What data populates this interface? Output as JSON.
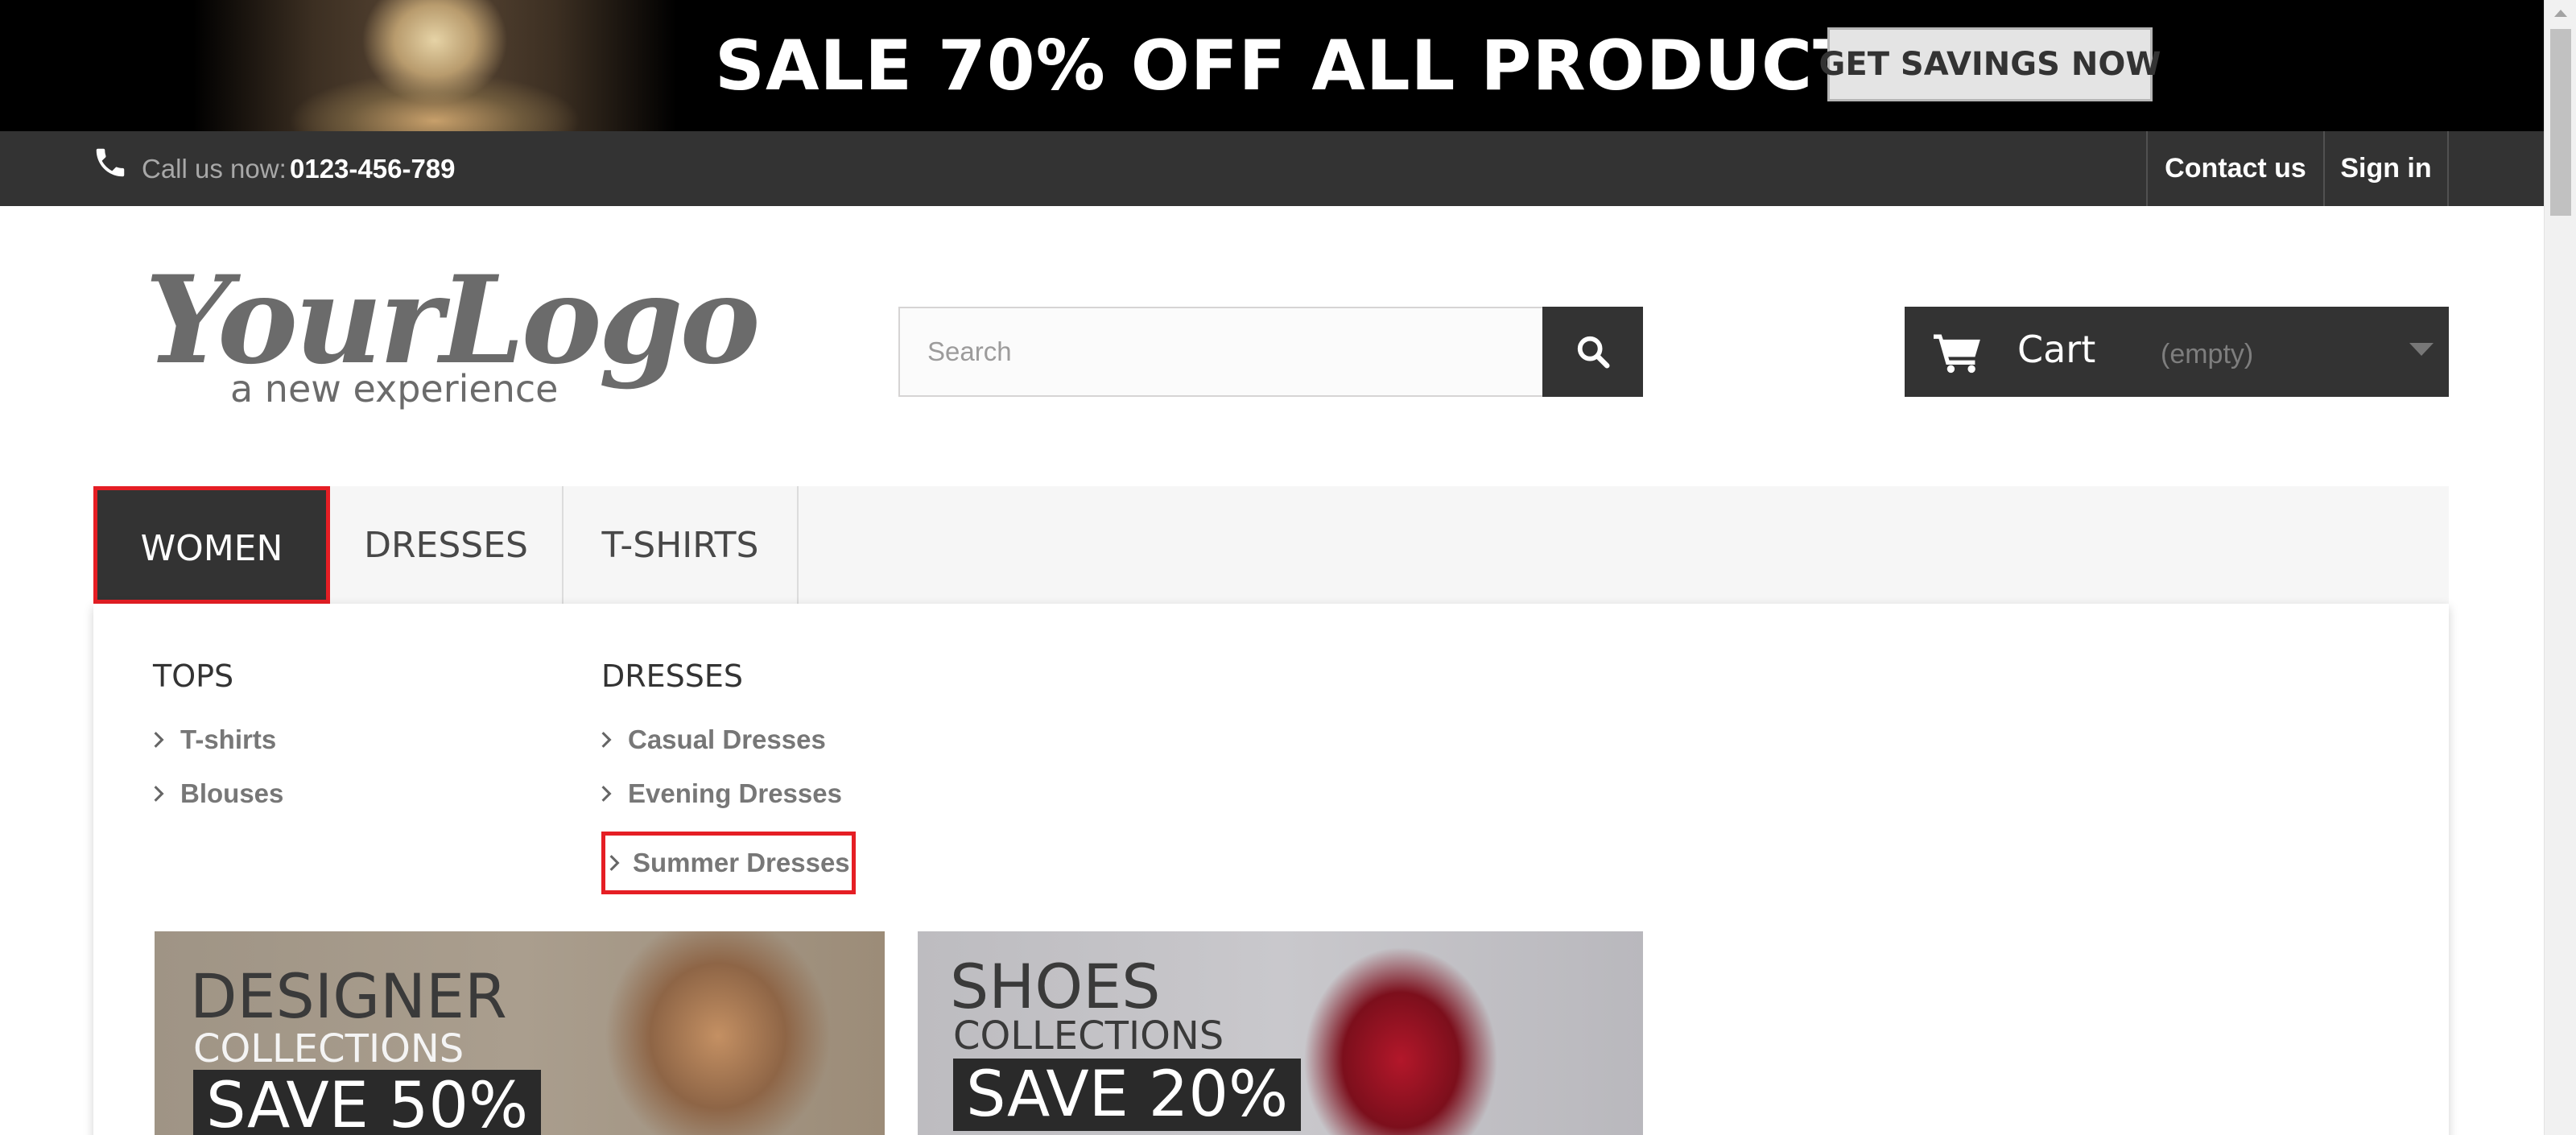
{
  "banner": {
    "headline": "SALE 70% OFF ALL PRODUCTS",
    "button_label": "GET SAVINGS NOW"
  },
  "topbar": {
    "call_label": "Call us now:",
    "phone_number": "0123-456-789",
    "contact_label": "Contact us",
    "signin_label": "Sign in"
  },
  "logo": {
    "main_text": "YourLogo",
    "tagline": "a new experience"
  },
  "search": {
    "placeholder": "Search"
  },
  "cart": {
    "label": "Cart",
    "status": "(empty)"
  },
  "menu": {
    "tabs": [
      {
        "label": "WOMEN"
      },
      {
        "label": "DRESSES"
      },
      {
        "label": "T-SHIRTS"
      }
    ]
  },
  "dropdown": {
    "tops": {
      "title": "TOPS",
      "items": [
        "T-shirts",
        "Blouses"
      ]
    },
    "dresses": {
      "title": "DRESSES",
      "items": [
        "Casual Dresses",
        "Evening Dresses",
        "Summer Dresses"
      ]
    }
  },
  "promos": {
    "designer": {
      "title": "DESIGNER",
      "subtitle": "COLLECTIONS",
      "save": "SAVE 50%"
    },
    "shoes": {
      "title": "SHOES",
      "subtitle": "COLLECTIONS",
      "save": "SAVE 20%"
    }
  },
  "colors": {
    "dark": "#333333",
    "highlight": "#e51e24",
    "menu_bg": "#f6f6f6"
  },
  "icons": [
    "phone-icon",
    "search-icon",
    "cart-icon",
    "caret-down-icon",
    "chevron-right-icon"
  ]
}
